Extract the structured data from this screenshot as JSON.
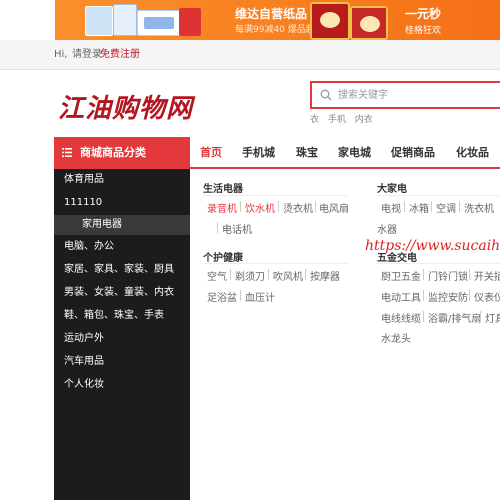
{
  "banner": {
    "title": "维达自营纸品",
    "subtitle": "每满99减40 爆品超值购",
    "right_title": "一元秒",
    "right_sub": "桂格狂欢"
  },
  "topbar": {
    "greeting": "Hi,",
    "login": "请登录",
    "register": "免费注册"
  },
  "logo": {
    "text": "江油购物网"
  },
  "search": {
    "placeholder": "搜索关键字",
    "hotwords": [
      "衣",
      "手机",
      "内衣"
    ]
  },
  "nav": {
    "category_header": "商城商品分类",
    "items": [
      "首页",
      "手机城",
      "珠宝",
      "家电城",
      "促销商品",
      "化妆品"
    ],
    "active_index": 0
  },
  "sidebar": {
    "items": [
      "体育用品",
      "111110",
      "家用电器",
      "电脑、办公",
      "家居、家具、家装、厨具",
      "男装、女装、童装、内衣",
      "鞋、箱包、珠宝、手表",
      "运动户外",
      "汽车用品",
      "个人化妆"
    ],
    "highlighted_index": 2
  },
  "panel": {
    "sections": [
      {
        "title": "生活电器",
        "links": [
          "录音机",
          "饮水机",
          "烫衣机",
          "电风扇",
          "电话机"
        ],
        "red": [
          0,
          1
        ]
      },
      {
        "title": "个护健康",
        "links": [
          "空气",
          "剃须刀",
          "吹风机",
          "按摩器",
          "足浴盆",
          "血压计"
        ]
      },
      {
        "title": "大家电",
        "links": [
          "电视",
          "冰箱",
          "空调",
          "洗衣机",
          "水器"
        ]
      },
      {
        "title": "五金交电",
        "links": [
          "厨卫五金",
          "门铃门锁",
          "开关插",
          "电动工具",
          "监控安防",
          "仪表仪",
          "电线线缆",
          "浴霸/排气扇",
          "灯具",
          "水龙头"
        ]
      }
    ]
  },
  "watermark": {
    "text": "https://www.sucaihuo"
  },
  "colors": {
    "accent": "#e4393c",
    "sidebar_bg": "#1c1c1c",
    "banner": "#f77f1f"
  }
}
